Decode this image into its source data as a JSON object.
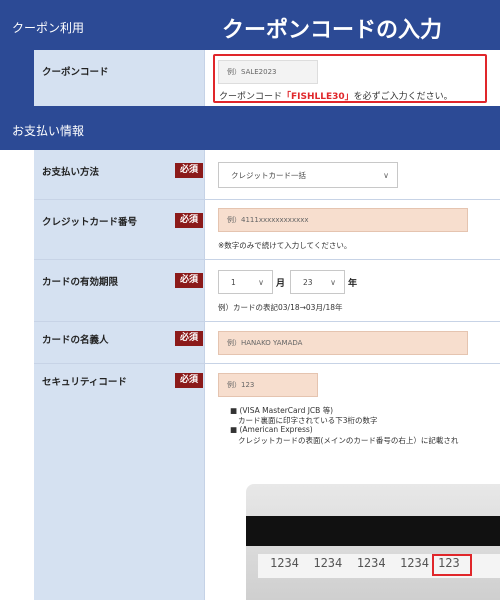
{
  "coupon_section": {
    "header": "クーポン利用",
    "overlay_title": "クーポンコードの入力",
    "field_label": "クーポンコード",
    "placeholder": "例）SALE2023",
    "instruction_prefix": "クーポンコード",
    "instruction_code": "「FISHLLE30」",
    "instruction_suffix": "を必ずご入力ください。"
  },
  "payment_section": {
    "header": "お支払い情報",
    "required_badge": "必須",
    "method": {
      "label": "お支払い方法",
      "selected": "クレジットカード一括"
    },
    "card_number": {
      "label": "クレジットカード番号",
      "placeholder": "例）4111xxxxxxxxxxxx",
      "note": "※数字のみで続けて入力してください。"
    },
    "expiry": {
      "label": "カードの有効期限",
      "month_value": "1",
      "month_unit": "月",
      "year_value": "23",
      "year_unit": "年",
      "note": "例）カードの表記03/18→03月/18年"
    },
    "holder": {
      "label": "カードの名義人",
      "placeholder": "例）HANAKO YAMADA"
    },
    "security": {
      "label": "セキュリティコード",
      "placeholder": "例）123",
      "bullet1": "(VISA MasterCard JCB 等)",
      "bullet1_detail": "カード裏面に印字されている下3桁の数字",
      "bullet2": "(American Express)",
      "bullet2_detail": "クレジットカードの表面(メインのカード番号の右上）に記載され",
      "card_digits": "1234  1234  1234  1234",
      "card_code": "123"
    }
  },
  "colors": {
    "header_blue": "#2c4a95",
    "label_bg": "#d5e1f1",
    "required_red": "#8b1a1a",
    "input_bg": "#f7dece",
    "highlight_red": "#e0262a"
  }
}
